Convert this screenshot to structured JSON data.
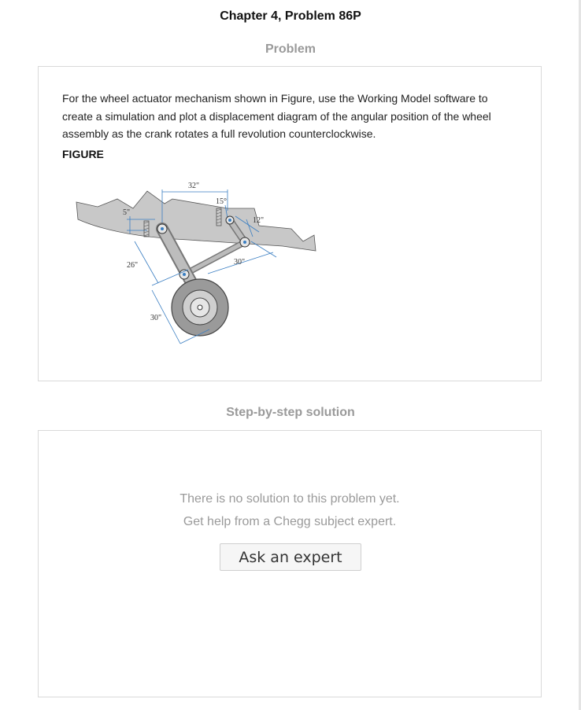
{
  "page": {
    "chapter_title": "Chapter 4, Problem 86P"
  },
  "problem": {
    "section_title": "Problem",
    "text": "For the wheel actuator mechanism shown in Figure, use the Working Model software to create a simulation and plot a displacement diagram of the angular position of the wheel assembly as the crank rotates a full revolution counterclockwise.",
    "figure_label": "FIGURE",
    "figure_dimensions": {
      "top_span": "32\"",
      "offset_left": "5\"",
      "angle": "15°",
      "crank_length": "12\"",
      "upper_link": "26\"",
      "coupler": "30\"",
      "lower_link": "30\""
    }
  },
  "solution": {
    "section_title": "Step-by-step solution",
    "empty_line1": "There is no solution to this problem yet.",
    "empty_line2": "Get help from a Chegg subject expert.",
    "ask_button_label": "Ask an expert"
  }
}
